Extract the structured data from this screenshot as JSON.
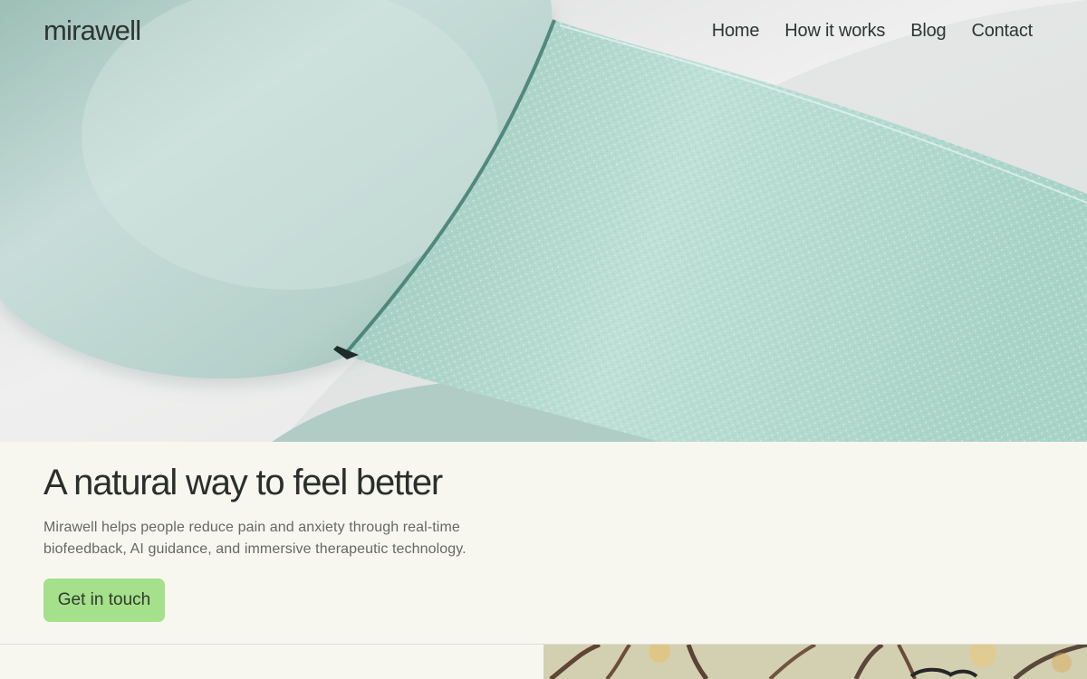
{
  "navigation": {
    "brand": "mirawell",
    "links": [
      {
        "label": "Home"
      },
      {
        "label": "How it works"
      },
      {
        "label": "Blog"
      },
      {
        "label": "Contact"
      }
    ]
  },
  "hero": {
    "image_description": "close-up of a mint green wearable band with textured strap"
  },
  "intro": {
    "title": "A natural way to feel better",
    "description": "Mirawell helps people reduce pain and anxiety through real-time biofeedback, AI guidance, and immersive therapeutic technology.",
    "cta_label": "Get in touch"
  },
  "secondary_image": {
    "image_description": "outdoor scene with trees and a person wearing glasses"
  },
  "colors": {
    "page_background": "#f7f7f0",
    "accent_green": "#a5e08a",
    "mint": "#b8d8cf",
    "text": "#2b2f2c",
    "muted_text": "#666963"
  },
  "icons": []
}
